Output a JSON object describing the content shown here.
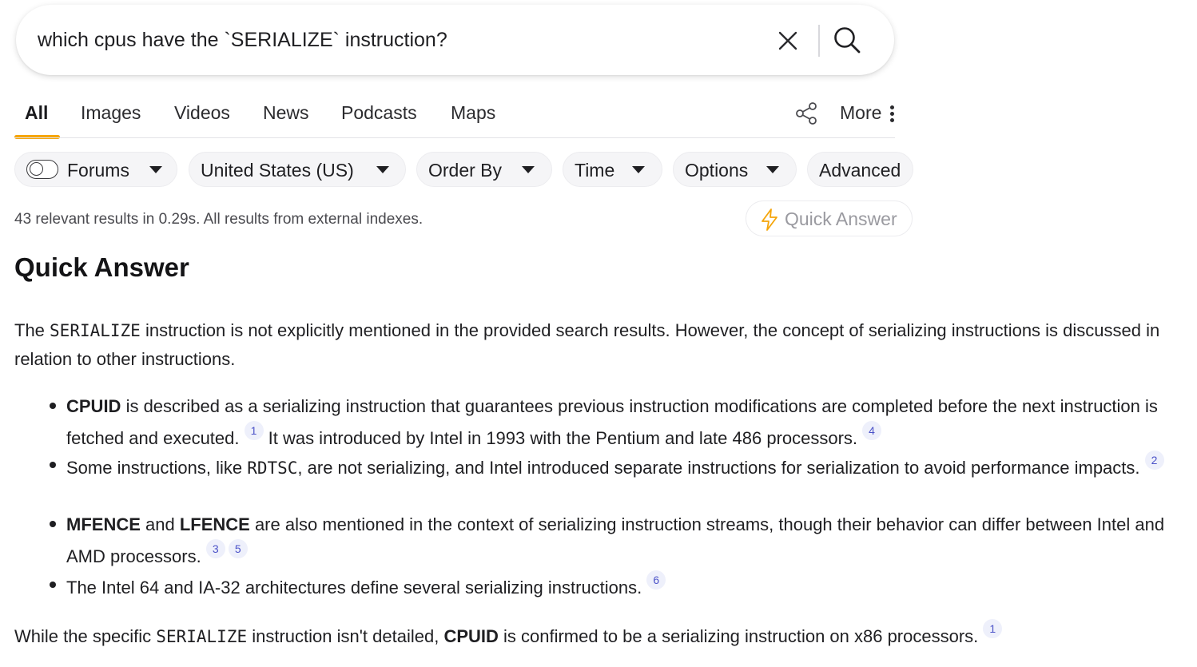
{
  "search": {
    "query": "which cpus have the `SERIALIZE` instruction?"
  },
  "tabs": [
    {
      "label": "All",
      "active": true
    },
    {
      "label": "Images"
    },
    {
      "label": "Videos"
    },
    {
      "label": "News"
    },
    {
      "label": "Podcasts"
    },
    {
      "label": "Maps"
    }
  ],
  "more_label": "More",
  "filters": {
    "forums": "Forums",
    "region": "United States (US)",
    "order_by": "Order By",
    "time": "Time",
    "options": "Options",
    "advanced": "Advanced"
  },
  "results_stats": "43 relevant results in 0.29s. All results from external indexes.",
  "quick_answer_button": "Quick Answer",
  "answer": {
    "heading": "Quick Answer",
    "intro": {
      "pre": "The ",
      "code": "SERIALIZE",
      "post": " instruction is not explicitly mentioned in the provided search results. However, the concept of serializing instructions is discussed in relation to other instructions."
    },
    "bullets": [
      {
        "bold": "CPUID",
        "text1": " is described as a serializing instruction that guarantees previous instruction modifications are completed before the next instruction is fetched and executed.",
        "cite1": "1",
        "text2": " It was introduced by Intel in 1993 with the Pentium and late 486 processors.",
        "cite2": "4"
      },
      {
        "pre": "Some instructions, like ",
        "code": "RDTSC",
        "post": ", are not serializing, and Intel introduced separate instructions for serialization to avoid performance impacts.",
        "cite": "2"
      },
      {
        "bold1": "MFENCE",
        "and": " and ",
        "bold2": "LFENCE",
        "text": " are also mentioned in the context of serializing instruction streams, though their behavior can differ between Intel and AMD processors.",
        "cite1": "3",
        "cite2": "5"
      },
      {
        "text": "The Intel 64 and IA-32 architectures define several serializing instructions.",
        "cite": "6"
      }
    ],
    "conclusion": {
      "pre": "While the specific ",
      "code": "SERIALIZE",
      "mid": " instruction isn't detailed, ",
      "bold": "CPUID",
      "post": " is confirmed to be a serializing instruction on x86 processors.",
      "cite": "1"
    }
  },
  "colors": {
    "accent": "#f5a50a",
    "citation_bg": "#eef0fb",
    "citation_text": "#4b52c8"
  }
}
